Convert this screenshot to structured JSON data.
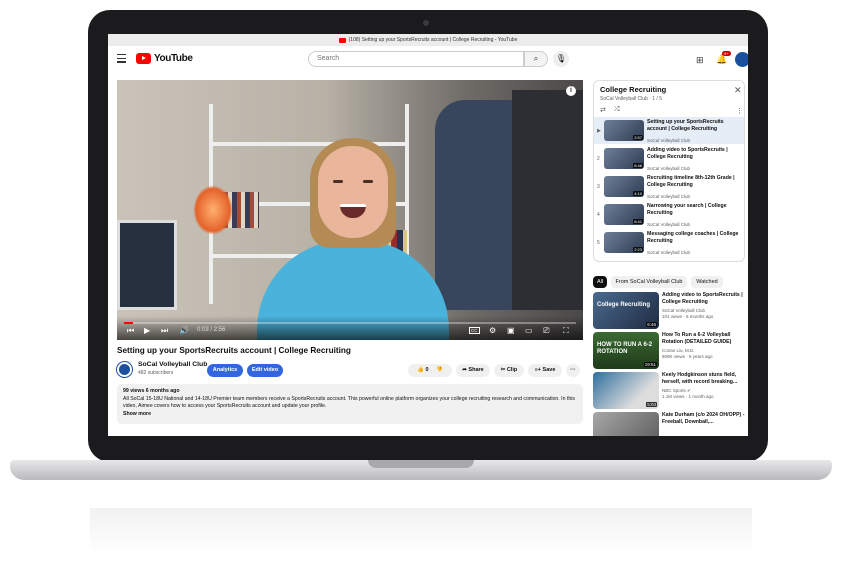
{
  "browser": {
    "tab_title": "(108) Setting up your SportsRecruits account | College Recruiting - YouTube"
  },
  "header": {
    "logo_text": "YouTube",
    "search_placeholder": "Search",
    "notifications_count": "9+"
  },
  "video": {
    "title": "Setting up your SportsRecruits account | College Recruiting",
    "current_time": "0:03 / 2:56",
    "progress": 0.02,
    "channel_name": "SoCal Volleyball Club",
    "subscribers": "482 subscribers",
    "analytics_label": "Analytics",
    "edit_label": "Edit video",
    "like_count": "0",
    "share_label": "Share",
    "clip_label": "Clip",
    "save_label": "Save",
    "more_label": "···",
    "stats": "99 views  6 months ago",
    "description": "All SoCal 15-18U National and 14-18U Premier team members receive a SportsRecruits account. This powerful online platform organizes your college recruiting research and communication. In this video, Aimee covers how to access your SportsRecruits account and update your profile.",
    "show_more": "Show more"
  },
  "playlist": {
    "title": "College Recruiting",
    "subtitle": "SoCal Volleyball Club · 1 / 5",
    "items": [
      {
        "index": "▶",
        "title": "Setting up your SportsRecruits account | College Recruiting",
        "channel": "SoCal Volleyball Club",
        "duration": "2:57"
      },
      {
        "index": "2",
        "title": "Adding video to SportsRecruits | College Recruiting",
        "channel": "SoCal Volleyball Club",
        "duration": "6:46"
      },
      {
        "index": "3",
        "title": "Recruiting timeline 8th-12th Grade | College Recruiting",
        "channel": "SoCal Volleyball Club",
        "duration": "4:10"
      },
      {
        "index": "4",
        "title": "Narrowing your search | College Recruiting",
        "channel": "SoCal Volleyball Club",
        "duration": "6:41"
      },
      {
        "index": "5",
        "title": "Messaging college coaches | College Recruiting",
        "channel": "SoCal Volleyball Club",
        "duration": "2:23"
      }
    ]
  },
  "chips": [
    "All",
    "From SoCal Volleyball Club",
    "Watched"
  ],
  "recommendations": [
    {
      "title": "Adding video to SportsRecruits | College Recruiting",
      "channel": "SoCal Volleyball Club",
      "meta": "101 views · 6 months ago",
      "duration": "6:46",
      "thumb_text": "College Recruiting"
    },
    {
      "title": "How To Run a 6-2 Volleyball Rotation (DETAILED GUIDE)",
      "channel": "Conan Liu, M.D.",
      "meta": "809K views · 5 years ago",
      "duration": "19:51",
      "thumb_text": "HOW TO RUN A 6-2 ROTATION"
    },
    {
      "title": "Keely Hodgkinson stuns field, herself, with record breaking...",
      "channel": "NBC Sports ✔",
      "meta": "1.1M views · 1 month ago",
      "duration": "5:03",
      "thumb_text": ""
    },
    {
      "title": "Kate Durham (c/o 2024 OH/OPP) - Freeball, Downball,...",
      "channel": "",
      "meta": "",
      "duration": "",
      "thumb_text": ""
    }
  ],
  "colors": {
    "brand_red": "#ff0000",
    "accent_blue": "#3166e0",
    "playlist_active": "#e5edf7"
  }
}
